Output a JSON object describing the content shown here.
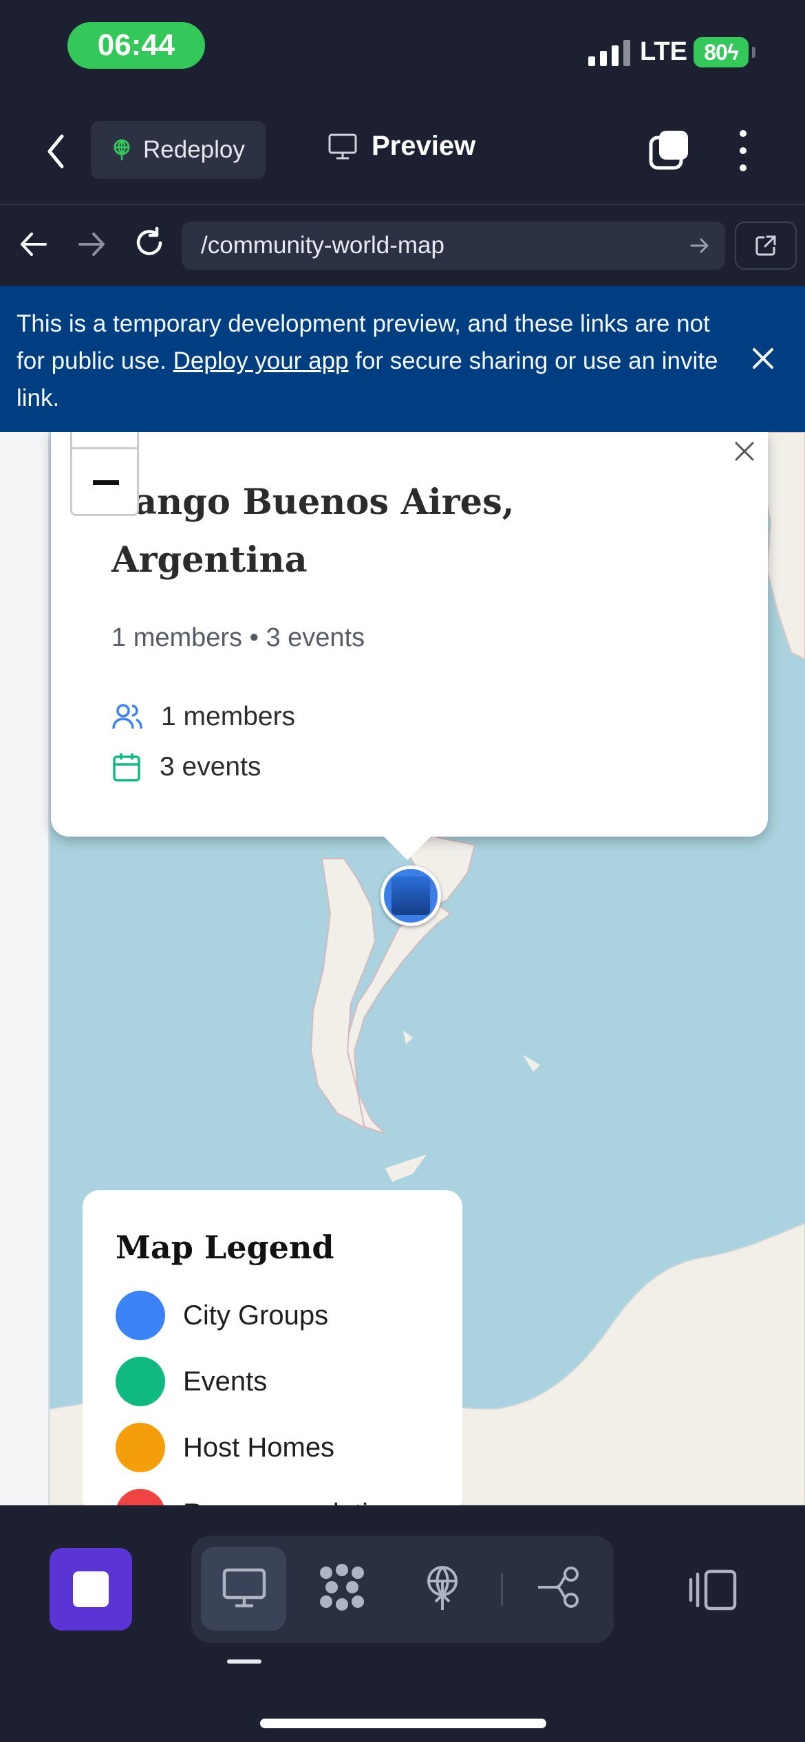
{
  "status_bar": {
    "time": "06:44",
    "network": "LTE",
    "battery": "80"
  },
  "toolbar": {
    "redeploy_label": "Redeploy",
    "preview_label": "Preview"
  },
  "url_bar": {
    "url": "/community-world-map"
  },
  "banner": {
    "text_before": "This is a temporary development preview, and these links are not for public use. ",
    "link": "Deploy your app",
    "text_after": " for secure sharing or use an invite link."
  },
  "popup": {
    "title": "Tango Buenos Aires, Argentina",
    "summary": "1 members • 3 events",
    "members_label": "1 members",
    "events_label": "3 events"
  },
  "legend": {
    "title": "Map Legend",
    "items": [
      {
        "label": "City Groups",
        "color": "#3b82f6"
      },
      {
        "label": "Events",
        "color": "#10b981"
      },
      {
        "label": "Host Homes",
        "color": "#f59e0b"
      },
      {
        "label": "Recommendations",
        "color": "#ef4444"
      }
    ]
  },
  "colors": {
    "accent": "#5b34d6",
    "banner": "#003e82",
    "map_water": "#aad3df",
    "land": "#f2efe9"
  }
}
